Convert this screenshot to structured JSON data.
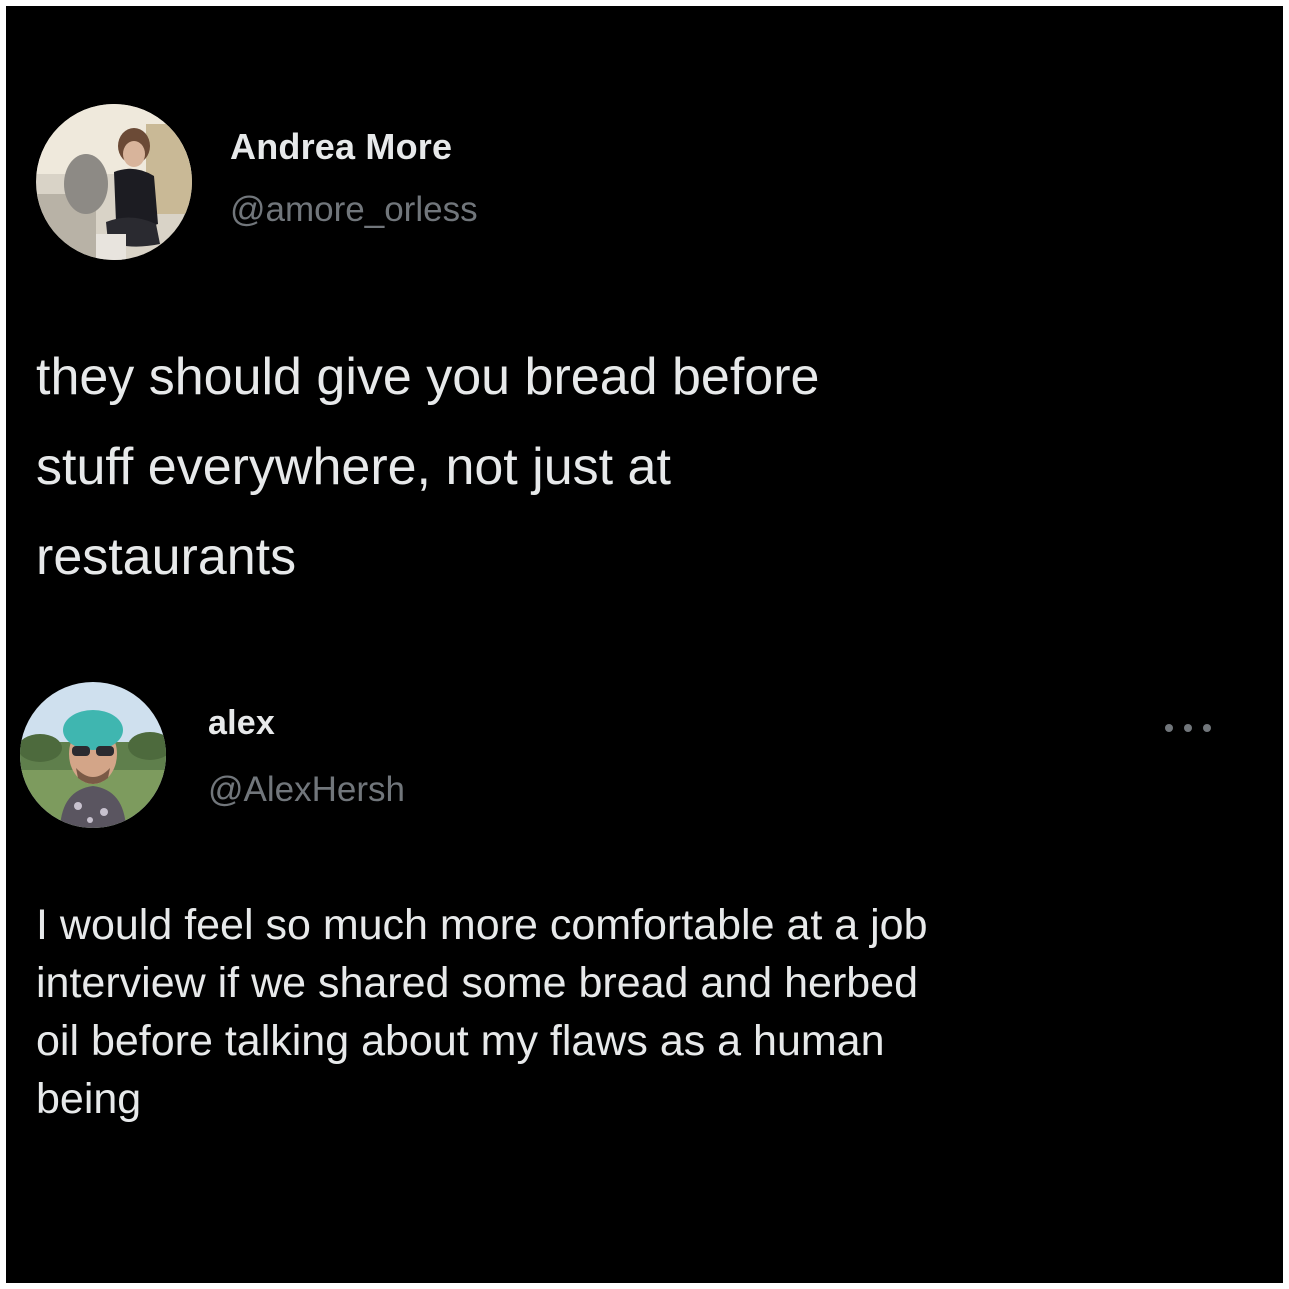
{
  "colors": {
    "background": "#000000",
    "frame": "#ffffff",
    "name_text": "#e7e9ea",
    "handle_text": "#71767b",
    "body_text": "#e7e9ea"
  },
  "tweets": [
    {
      "author_name": "Andrea More",
      "author_handle": "@amore_orless",
      "text": "they should give you bread before\nstuff everywhere, not just at\nrestaurants"
    },
    {
      "author_name": "alex",
      "author_handle": "@AlexHersh",
      "more_icon": "more-options-icon",
      "text": "I would feel so much more comfortable at a job\ninterview if we shared some bread and herbed\noil before talking about my flaws as a human\nbeing"
    }
  ]
}
